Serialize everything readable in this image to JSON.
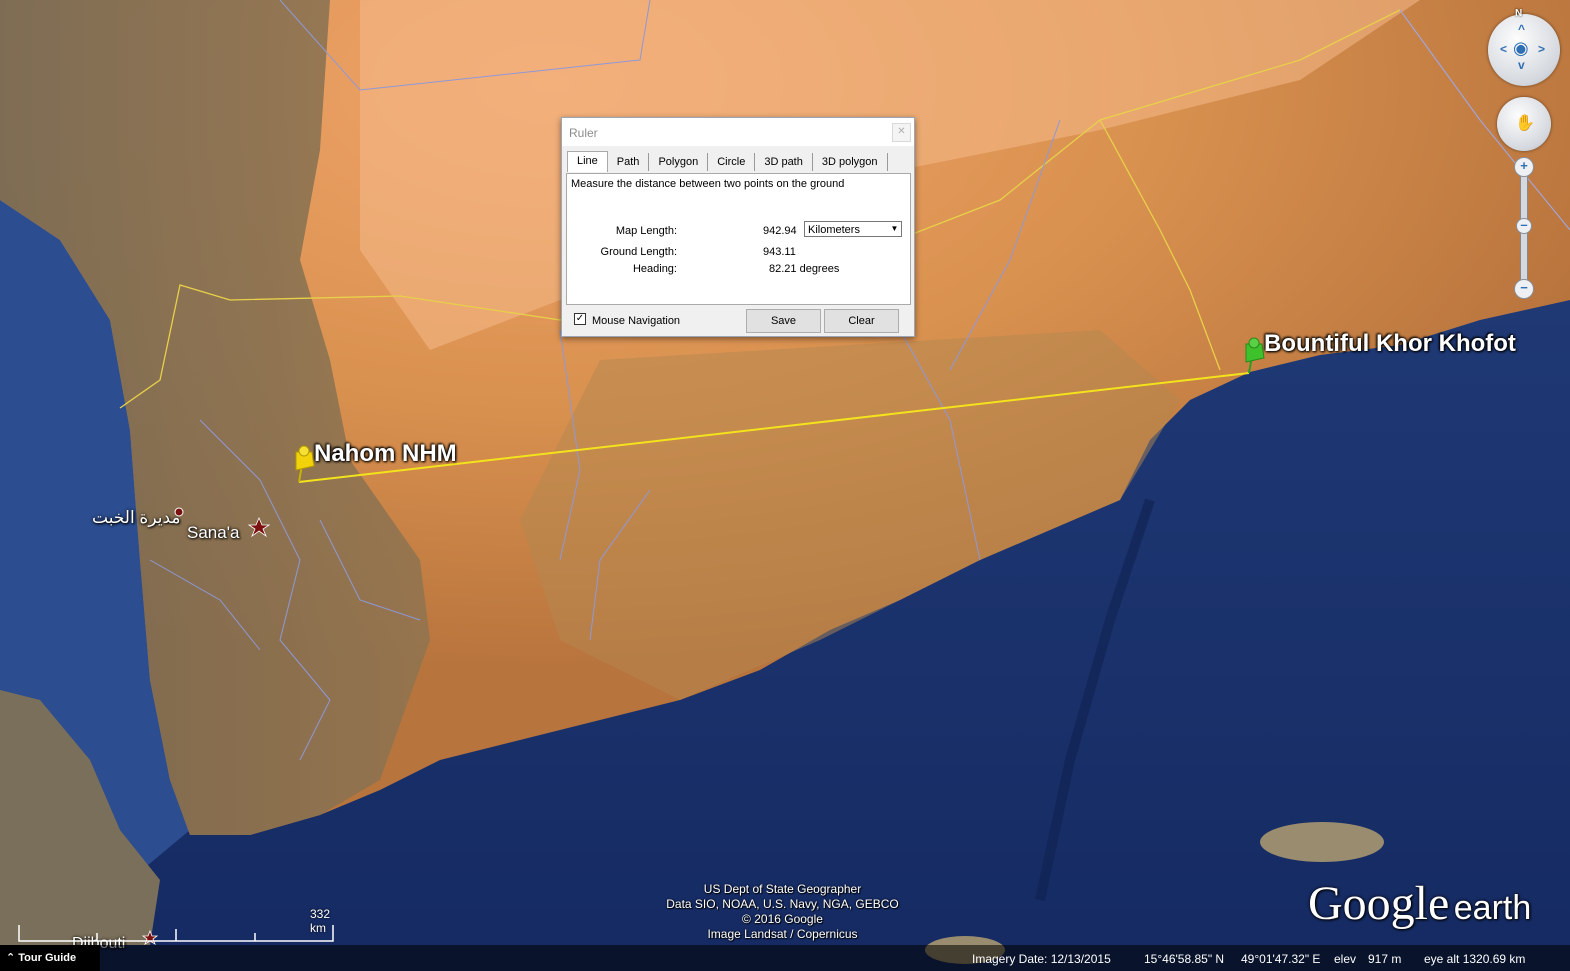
{
  "map": {
    "placemarks": [
      {
        "name": "Nahom NHM",
        "pin_color": "#f2d20a"
      },
      {
        "name": "Bountiful Khor Khofot",
        "pin_color": "#3fc12b"
      }
    ],
    "places": [
      {
        "name": "Sana'a"
      },
      {
        "name": "مديرة الخبت"
      },
      {
        "name": "Djibouti"
      }
    ],
    "line_color": "#f3e21c"
  },
  "ruler": {
    "title": "Ruler",
    "tabs": [
      "Line",
      "Path",
      "Polygon",
      "Circle",
      "3D path",
      "3D polygon"
    ],
    "active_tab": "Line",
    "description": "Measure the distance between two points on the ground",
    "map_length_label": "Map Length:",
    "map_length_value": "942.94",
    "units_selected": "Kilometers",
    "ground_length_label": "Ground Length:",
    "ground_length_value": "943.11",
    "heading_label": "Heading:",
    "heading_value": "82.21 degrees",
    "mouse_navigation_label": "Mouse Navigation",
    "mouse_navigation_checked": true,
    "save_label": "Save",
    "clear_label": "Clear"
  },
  "nav": {
    "north_label": "N",
    "zoom_in": "+",
    "zoom_out": "−"
  },
  "attribution": [
    "US Dept of State Geographer",
    "Data SIO, NOAA, U.S. Navy, NGA, GEBCO",
    "© 2016 Google",
    "Image Landsat / Copernicus"
  ],
  "logo": {
    "google": "Google",
    "earth": "earth"
  },
  "scale": {
    "label": "332 km"
  },
  "status": {
    "tour_guide": "Tour Guide",
    "imagery_date": "Imagery Date: 12/13/2015",
    "lat": "15°46'58.85\" N",
    "lon": "49°01'47.32\" E",
    "elev_label": "elev",
    "elev_value": "917 m",
    "eye_alt": "eye alt 1320.69 km"
  }
}
